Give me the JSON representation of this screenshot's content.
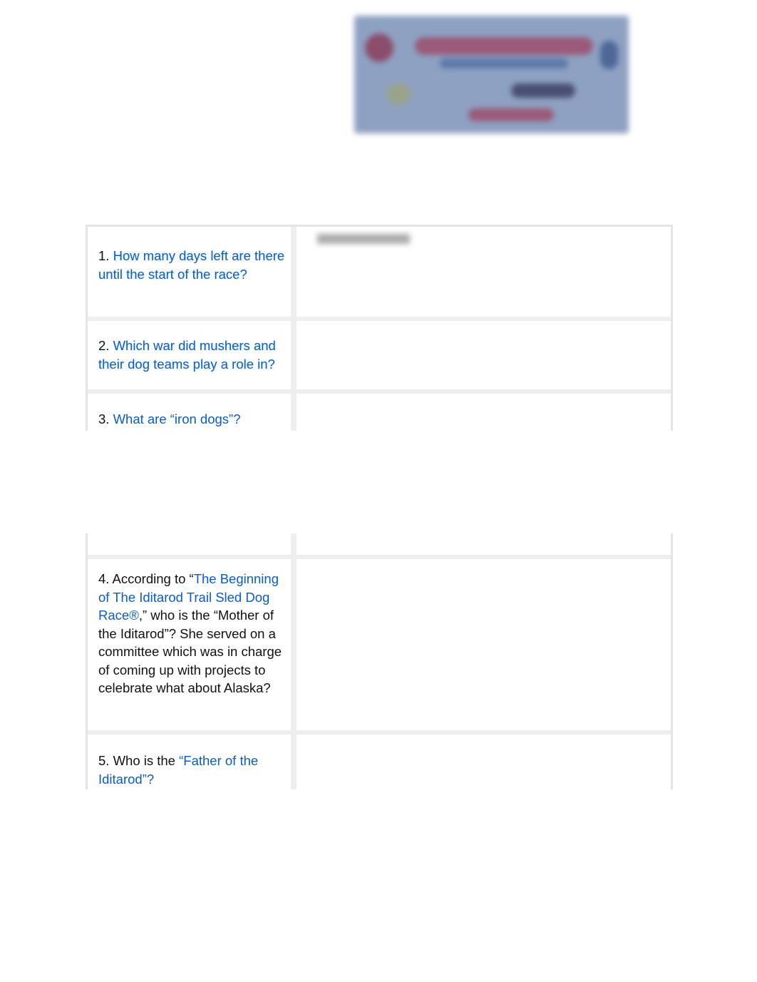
{
  "banner": {
    "alt": "Iditarod banner (blurred)"
  },
  "answer_hint": "",
  "questions": [
    {
      "num": "1.",
      "link": "How many days left are there until the start of the race?"
    },
    {
      "num": "2.",
      "link": "Which war did mushers and their dog teams play a role in?"
    },
    {
      "num": "3.",
      "link": "What are “iron dogs”?"
    },
    {
      "pre": "4. According to “",
      "link": "The Beginning of The Iditarod Trail Sled Dog Race®",
      "post": ",” who is the “Mother of the Iditarod”? She served on a committee which was in charge of coming up with projects to celebrate what about Alaska?"
    },
    {
      "pre": "5. Who is the ",
      "link": "“Father of the Iditarod”?"
    }
  ],
  "colors": {
    "link": "#0b5cc4"
  }
}
